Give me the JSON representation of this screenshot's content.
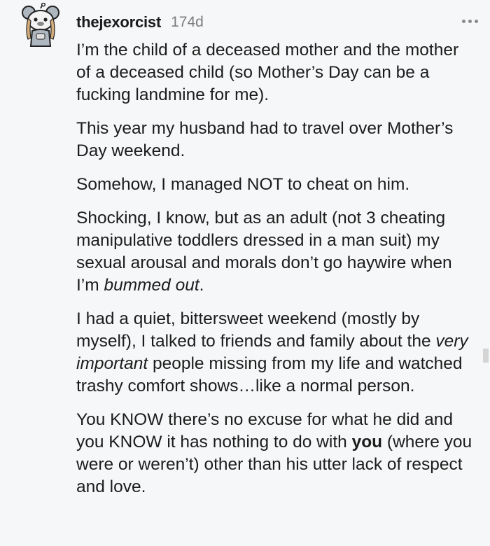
{
  "comment": {
    "author": "thejexorcist",
    "age": "174d",
    "more_icon": "ellipsis-icon",
    "avatar_icon": "snoo-avatar-icon",
    "paragraphs": [
      {
        "p1": "I’m the child of a deceased mother and the mother of a deceased child (so Mother’s Day can be a fucking landmine for me)."
      },
      {
        "p1": "This year my husband had to travel over Mother’s Day weekend."
      },
      {
        "p1": "Somehow, I managed NOT to cheat on him."
      },
      {
        "p1": "Shocking, I know, but as an adult (not 3 cheating manipulative toddlers dressed in a man suit) my sexual arousal and morals don’t go haywire when I’m ",
        "em": "bummed out",
        "p2": "."
      },
      {
        "p1": "I had a quiet, bittersweet weekend (mostly by myself), I talked to friends and family about the ",
        "em": "very important",
        "p2": " people missing from my life and watched trashy comfort shows…like a normal person."
      },
      {
        "p1": "You KNOW there’s no excuse for what he did and you KNOW it has nothing to do with ",
        "strong": "you",
        "p2": " (where you were or weren’t) other than his utter lack of respect and love."
      }
    ]
  },
  "colors": {
    "background": "#f6f7f8",
    "text": "#1c1c1c",
    "meta": "#7c7c7c"
  }
}
